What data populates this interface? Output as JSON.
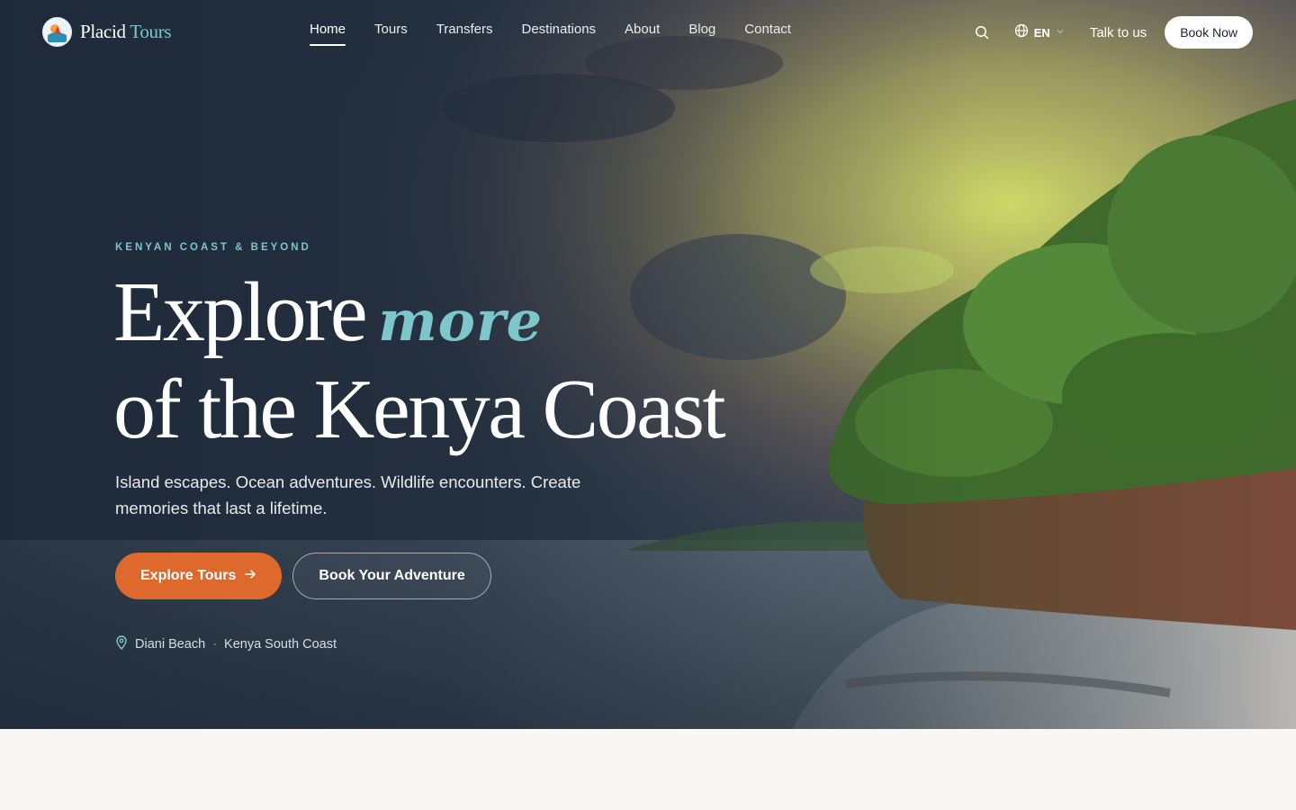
{
  "brand": {
    "name_main": "Placid",
    "name_accent": "Tours"
  },
  "nav": {
    "items": [
      {
        "label": "Home",
        "active": true
      },
      {
        "label": "Tours",
        "active": false
      },
      {
        "label": "Transfers",
        "active": false
      },
      {
        "label": "Destinations",
        "active": false
      },
      {
        "label": "About",
        "active": false
      },
      {
        "label": "Blog",
        "active": false
      },
      {
        "label": "Contact",
        "active": false
      }
    ],
    "search_icon": "search-icon",
    "language": "EN",
    "talk_label": "Talk to us",
    "book_label": "Book Now"
  },
  "hero": {
    "eyebrow": "KENYAN COAST & BEYOND",
    "headline_part1": "Explore",
    "headline_script": "more",
    "headline_line2": "of the Kenya Coast",
    "lede": "Island escapes. Ocean adventures. Wildlife encounters. Create memories that last a lifetime.",
    "cta_primary": "Explore Tours",
    "cta_secondary": "Book Your Adventure",
    "location_place": "Diani Beach",
    "location_region": "Kenya South Coast"
  },
  "colors": {
    "accent_teal": "#7cc6cc",
    "primary_orange": "#dd6a2c",
    "page_background": "#f8f7f4"
  }
}
